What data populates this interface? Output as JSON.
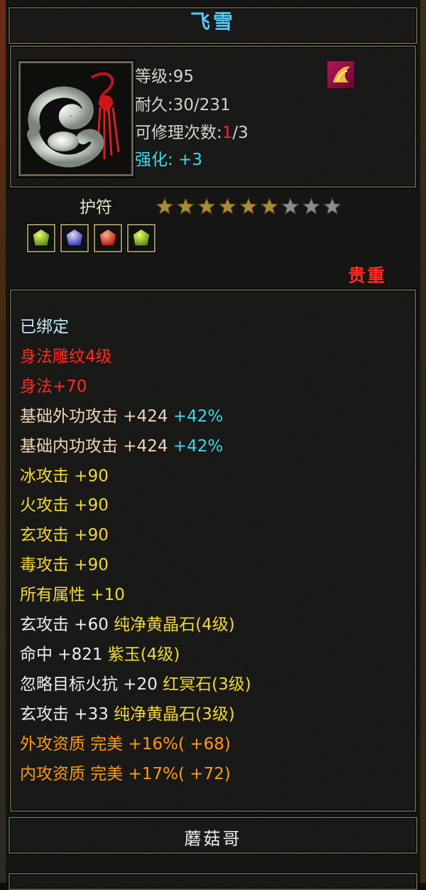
{
  "item": {
    "name": "飞雪",
    "level": "等级:95",
    "durability": "耐久:30/231",
    "repair_label": "可修理次数:",
    "repair_current": "1",
    "repair_total": "/3",
    "enhance_label": "强化: ",
    "enhance_value": "+3",
    "type": "护符",
    "stars_filled": 6,
    "stars_total": 9,
    "rarity": "贵重",
    "owner": "蘑菇哥"
  },
  "gems": [
    "green-gem-icon",
    "blue-gem-icon",
    "red-gem-icon",
    "green-gem-icon"
  ],
  "properties": [
    {
      "parts": [
        {
          "t": "已绑定",
          "c": "#bfe7f2"
        }
      ]
    },
    {
      "parts": [
        {
          "t": "身法雕纹4级",
          "c": "#ff2a22"
        }
      ]
    },
    {
      "parts": [
        {
          "t": "身法+70",
          "c": "#ff2a22"
        }
      ]
    },
    {
      "parts": [
        {
          "t": "基础外功攻击  +424 ",
          "c": "#f0d6b8"
        },
        {
          "t": "+42%",
          "c": "#3ed9ec"
        }
      ]
    },
    {
      "parts": [
        {
          "t": "基础内功攻击  +424 ",
          "c": "#f0d6b8"
        },
        {
          "t": "+42%",
          "c": "#3ed9ec"
        }
      ]
    },
    {
      "parts": [
        {
          "t": "冰攻击  +90",
          "c": "#f2d63a"
        }
      ]
    },
    {
      "parts": [
        {
          "t": "火攻击  +90",
          "c": "#f2d63a"
        }
      ]
    },
    {
      "parts": [
        {
          "t": "玄攻击  +90",
          "c": "#f2d63a"
        }
      ]
    },
    {
      "parts": [
        {
          "t": "毒攻击  +90",
          "c": "#f2d63a"
        }
      ]
    },
    {
      "parts": [
        {
          "t": "所有属性  +10",
          "c": "#f2d63a"
        }
      ]
    },
    {
      "parts": [
        {
          "t": "玄攻击  +60  ",
          "c": "#ededed"
        },
        {
          "t": "纯净黄晶石(4级)",
          "c": "#f2d63a"
        }
      ]
    },
    {
      "parts": [
        {
          "t": "命中  +821  ",
          "c": "#ededed"
        },
        {
          "t": "紫玉(4级)",
          "c": "#f2d63a"
        }
      ]
    },
    {
      "parts": [
        {
          "t": "忽略目标火抗  +20  ",
          "c": "#ededed"
        },
        {
          "t": "红冥石(3级)",
          "c": "#f2d63a"
        }
      ]
    },
    {
      "parts": [
        {
          "t": "玄攻击  +33  ",
          "c": "#ededed"
        },
        {
          "t": "纯净黄晶石(3级)",
          "c": "#f2d63a"
        }
      ]
    },
    {
      "parts": [
        {
          "t": "外攻资质   完美  +16%(  +68)",
          "c": "#ff9a1a"
        }
      ]
    },
    {
      "parts": [
        {
          "t": "内攻资质   完美  +17%(  +72)",
          "c": "#ff9a1a"
        }
      ]
    }
  ]
}
